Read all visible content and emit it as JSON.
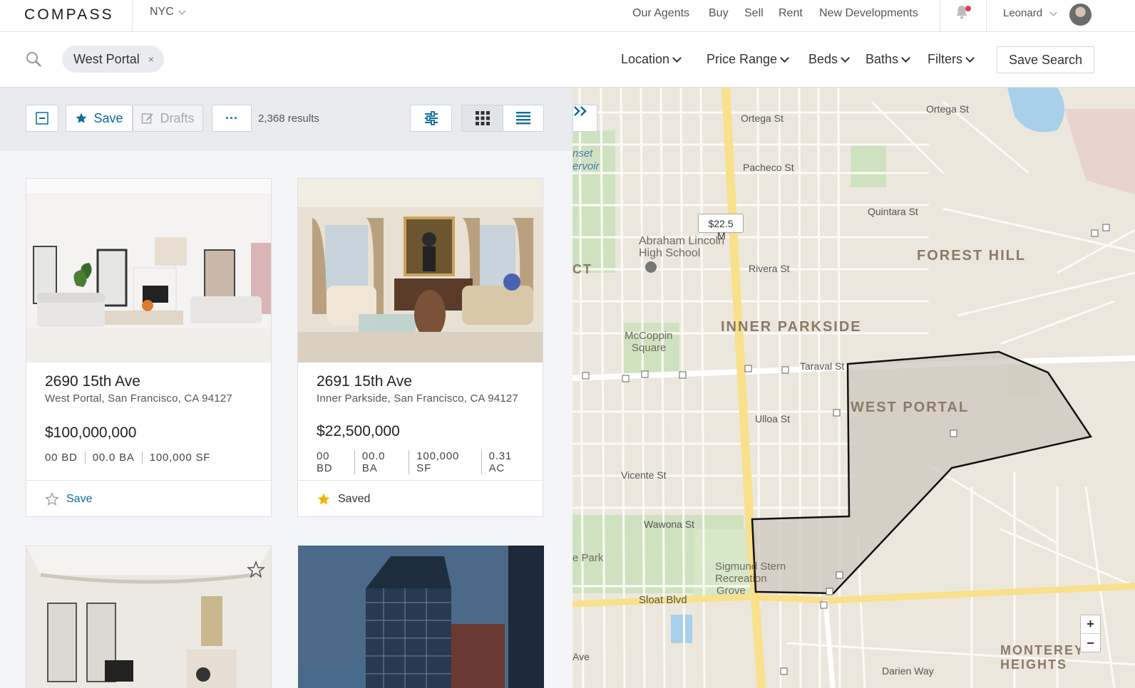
{
  "brand": "COMPASS",
  "market": "NYC",
  "nav": {
    "links": [
      "Our Agents",
      "Buy",
      "Sell",
      "Rent",
      "New Developments"
    ],
    "user": "Leonard"
  },
  "search": {
    "chip": "West Portal",
    "chip_remove": "×",
    "filters": [
      "Location",
      "Price Range",
      "Beds",
      "Baths",
      "Filters"
    ],
    "save_search": "Save Search"
  },
  "toolbar": {
    "save": "Save",
    "drafts": "Drafts",
    "more": "···",
    "results": "2,368 results"
  },
  "listings": [
    {
      "title": "2690 15th Ave",
      "address": "West Portal,  San Francisco, CA 94127",
      "price": "$100,000,000",
      "stats": [
        "00 BD",
        "00.0 BA",
        "100,000 SF"
      ],
      "footer": "Save",
      "saved": false
    },
    {
      "title": "2691 15th Ave",
      "address": "Inner Parkside, San Francisco, CA 94127",
      "price": "$22,500,000",
      "stats": [
        "00 BD",
        "00.0 BA",
        "100,000 SF",
        "0.31 AC"
      ],
      "footer": "Saved",
      "saved": true
    }
  ],
  "map": {
    "price_pin": "$22.5",
    "price_pin_suffix": "M",
    "neighborhoods": [
      "INNER PARKSIDE",
      "FOREST HILL",
      "WEST PORTAL",
      "MONTEREY",
      "HEIGHTS"
    ],
    "places": [
      "Abraham Lincoln",
      "High School",
      "McCoppin",
      "Square",
      "Sigmund Stern",
      "Recreation",
      "Grove",
      "nset",
      "ervoir",
      "e Park",
      "CT"
    ],
    "streets_h": [
      "Ortega St",
      "Ortega St",
      "Pacheco St",
      "Quintara St",
      "Rivera St",
      "Taraval St",
      "Ulloa St",
      "Vicente St",
      "Wawona St",
      "Sloat Blvd",
      "Darien Way",
      "Ave",
      "Rivera St"
    ],
    "zoom_in": "+",
    "zoom_out": "−"
  },
  "colors": {
    "accent": "#0b6ba0",
    "star": "#f5b301",
    "map_bg": "#ece7dc",
    "main_road": "#f9e08a",
    "polygon": "#cfc7bf"
  }
}
